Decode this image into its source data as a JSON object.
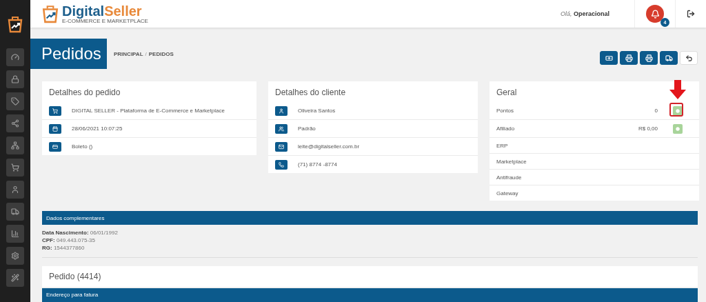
{
  "logo": {
    "word_1": "Digital",
    "word_2": "Seller",
    "tagline": "E-COMMERCE E MARKETPLACE"
  },
  "header": {
    "greeting": "Olá,",
    "user": "Operacional",
    "notifications": "4"
  },
  "page": {
    "title": "Pedidos",
    "breadcrumb": [
      "PRINCIPAL",
      "PEDIDOS"
    ],
    "breadcrumb_separator": "/"
  },
  "toolbar": [
    {
      "kind": "primary"
    },
    {
      "kind": "primary"
    },
    {
      "kind": "primary"
    },
    {
      "kind": "primary"
    },
    {
      "kind": "plain"
    }
  ],
  "order_details": {
    "title": "Detalhes do pedido",
    "rows": [
      "DIGITAL SELLER - Plataforma de E-Commerce e Marketplace",
      "28/06/2021 10:07:25",
      "Boleto ()"
    ]
  },
  "client_details": {
    "title": "Detalhes do cliente",
    "rows": [
      "Oliveira Santos",
      "Padrão",
      "leite@digitalseller.com.br",
      "(71)  8774 -8774"
    ]
  },
  "general": {
    "title": "Geral",
    "rows": [
      {
        "label": "Pontos",
        "value": "0",
        "kind": "action",
        "highlighted": true
      },
      {
        "label": "Afiliado",
        "value": "R$ 0,00",
        "kind": "action",
        "highlighted": false
      },
      {
        "label": "ERP",
        "kind": "plain",
        "highlighted": false
      },
      {
        "label": "Marketplace",
        "kind": "plain",
        "highlighted": false
      },
      {
        "label": "Antifraude",
        "kind": "plain",
        "highlighted": false
      },
      {
        "label": "Gateway",
        "kind": "plain",
        "highlighted": false
      }
    ]
  },
  "complementary": {
    "title": "Dados complementares",
    "lines": [
      "**Data Nascimento:** 06/01/1992",
      "**CPF:** 049.443.075-35",
      "**RG:** 1544377860"
    ]
  },
  "order": {
    "title": "Pedido (4414)",
    "section": "Endereço para fatura"
  }
}
